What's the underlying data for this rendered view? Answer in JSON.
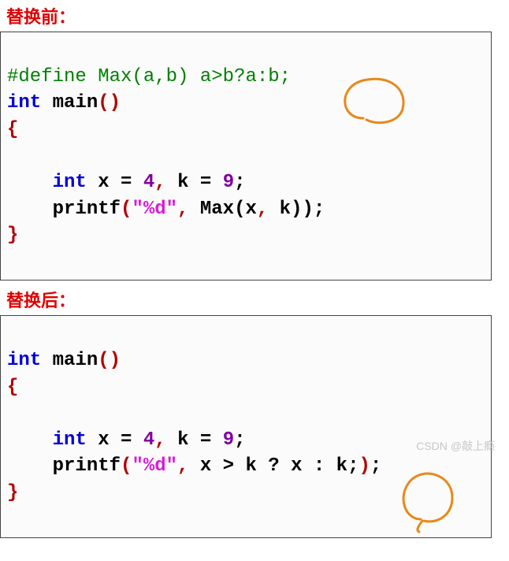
{
  "labels": {
    "before": "替换前：",
    "after": "替换后："
  },
  "code_before": {
    "line1_define": "#define Max(a,b) a>b?a:b;",
    "kw_int": "int",
    "main": " main",
    "paren": "()",
    "lbrace": "{",
    "indent": "    ",
    "decl_int": "int",
    "decl_sp1": " x ",
    "eq1": "=",
    "sp": " ",
    "num4": "4",
    "comma1": ",",
    "decl_sp2": " k ",
    "eq2": "=",
    "num9": "9",
    "semi1": ";",
    "printf": "printf",
    "lp": "(",
    "fmt": "\"%d\"",
    "comma2": ",",
    "arg": " Max(x",
    "comma3": ",",
    "arg2": " k))",
    "semi2": ";",
    "rbrace": "}"
  },
  "code_after": {
    "kw_int": "int",
    "main": " main",
    "paren": "()",
    "lbrace": "{",
    "indent": "    ",
    "decl_int": "int",
    "decl_sp1": " x ",
    "eq1": "=",
    "sp": " ",
    "num4": "4",
    "comma1": ",",
    "decl_sp2": " k ",
    "eq2": "=",
    "num9": "9",
    "semi1": ";",
    "printf": "printf",
    "lp": "(",
    "fmt": "\"%d\"",
    "comma2": ",",
    "expr": " x > k ? x : k",
    "semi_inner": ";",
    "rp": ")",
    "semi2": ";",
    "rbrace": "}"
  },
  "watermark": "CSDN @敲上瘾"
}
